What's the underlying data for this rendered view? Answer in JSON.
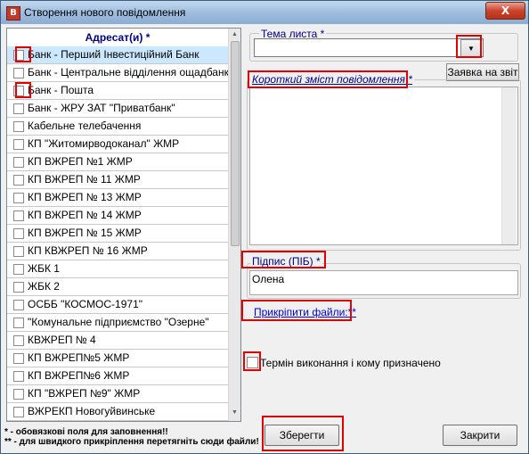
{
  "window": {
    "title": "Створення нового повідомлення",
    "app_icon": "В",
    "close_label": "X"
  },
  "recipients": {
    "header": "Адресат(и) *",
    "items": [
      "Банк - Перший Інвестиційний Банк",
      "Банк - Центральне відділення ощадбанк",
      "Банк - Пошта",
      "Банк - ЖРУ ЗАТ \"Приватбанк\"",
      "Кабельне телебачення",
      "КП \"Житомирводоканал\" ЖМР",
      "КП ВЖРЕП №1 ЖМР",
      "КП ВЖРЕП № 11 ЖМР",
      "КП ВЖРЕП № 13 ЖМР",
      "КП ВЖРЕП № 14 ЖМР",
      "КП ВЖРЕП № 15 ЖМР",
      "КП КВЖРЕП № 16 ЖМР",
      "ЖБК 1",
      "ЖБК 2",
      "ОСББ \"КОСМОС-1971\"",
      "\"Комунальне підприємство \"Озерне\"",
      "КВЖРЕП № 4",
      "КП ВЖРЕП№5 ЖМР",
      "КП ВЖРЕП№6 ЖМР",
      "КП \"ВЖРЕП №9\" ЖМР",
      "ВЖРЕКП Новогуйвинське"
    ],
    "selected_index": 0
  },
  "legend": {
    "line1": "* - обовязкові поля для заповнення!!",
    "line2": "** - для швидкого прикріплення перетягніть сюди файли!"
  },
  "subject": {
    "label": "Тема листа *",
    "value": ""
  },
  "request_button": "Заявка на звіт",
  "summary": {
    "label": "Короткий зміст повідомлення *",
    "value": ""
  },
  "signature": {
    "label": "Підпис (ПІБ) *",
    "value": "Олена"
  },
  "attach_link": "Прикріпити файли:**",
  "deadline_checkbox_label": "Термін виконання і кому призначено",
  "buttons": {
    "save": "Зберегти",
    "close": "Закрити"
  }
}
